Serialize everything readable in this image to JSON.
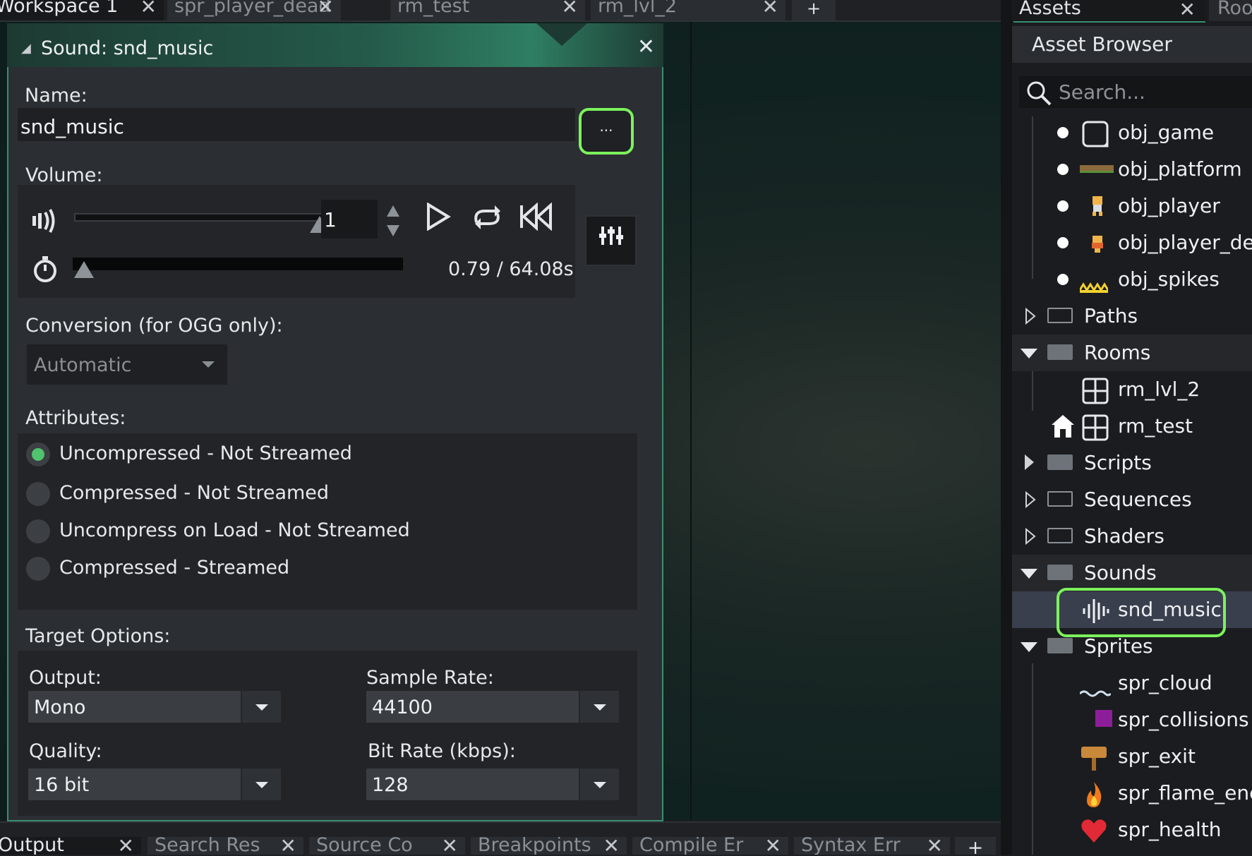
{
  "top_tabs": [
    {
      "label": "Workspace 1",
      "active": true
    },
    {
      "label": "spr_player_dead",
      "active": false
    },
    {
      "label": "rm_test",
      "active": false
    },
    {
      "label": "rm_lvl_2",
      "active": false
    }
  ],
  "add_tab_label": "+",
  "sound_window": {
    "title": "Sound: snd_music",
    "name_label": "Name:",
    "name_value": "snd_music",
    "more_button": "...",
    "volume_label": "Volume:",
    "volume_value": "1",
    "time_readout": "0.79 / 64.08s",
    "volume_level": 1.0,
    "playback_fraction": 0.012,
    "conversion_label": "Conversion (for OGG only):",
    "conversion_value": "Automatic",
    "attributes_label": "Attributes:",
    "attributes": [
      {
        "label": "Uncompressed - Not Streamed",
        "selected": true
      },
      {
        "label": "Compressed - Not Streamed",
        "selected": false
      },
      {
        "label": "Uncompress on Load - Not Streamed",
        "selected": false
      },
      {
        "label": "Compressed - Streamed",
        "selected": false
      }
    ],
    "target_label": "Target Options:",
    "output_label": "Output:",
    "output_value": "Mono",
    "sample_rate_label": "Sample Rate:",
    "sample_rate_value": "44100",
    "quality_label": "Quality:",
    "quality_value": "16 bit",
    "bit_rate_label": "Bit Rate (kbps):",
    "bit_rate_value": "128"
  },
  "bottom_tabs": [
    {
      "label": "Output",
      "active": true
    },
    {
      "label": "Search Res",
      "active": false
    },
    {
      "label": "Source Co",
      "active": false
    },
    {
      "label": "Breakpoints",
      "active": false
    },
    {
      "label": "Compile Er",
      "active": false
    },
    {
      "label": "Syntax Err",
      "active": false
    }
  ],
  "assets": {
    "tabs": [
      "Assets",
      "Roo"
    ],
    "header": "Asset Browser",
    "search_placeholder": "Search...",
    "tree": [
      {
        "label": "obj_game"
      },
      {
        "label": "obj_platform"
      },
      {
        "label": "obj_player"
      },
      {
        "label": "obj_player_dea"
      },
      {
        "label": "obj_spikes"
      },
      {
        "label": "Paths"
      },
      {
        "label": "Rooms"
      },
      {
        "label": "rm_lvl_2"
      },
      {
        "label": "rm_test"
      },
      {
        "label": "Scripts"
      },
      {
        "label": "Sequences"
      },
      {
        "label": "Shaders"
      },
      {
        "label": "Sounds"
      },
      {
        "label": "snd_music"
      },
      {
        "label": "Sprites"
      },
      {
        "label": "spr_cloud"
      },
      {
        "label": "spr_collisions"
      },
      {
        "label": "spr_exit"
      },
      {
        "label": "spr_flame_ene"
      },
      {
        "label": "spr_health"
      }
    ]
  },
  "colors": {
    "accent_green": "#7cf25d",
    "radio_on": "#4fc36d",
    "title_teal": "#2f7e63"
  }
}
